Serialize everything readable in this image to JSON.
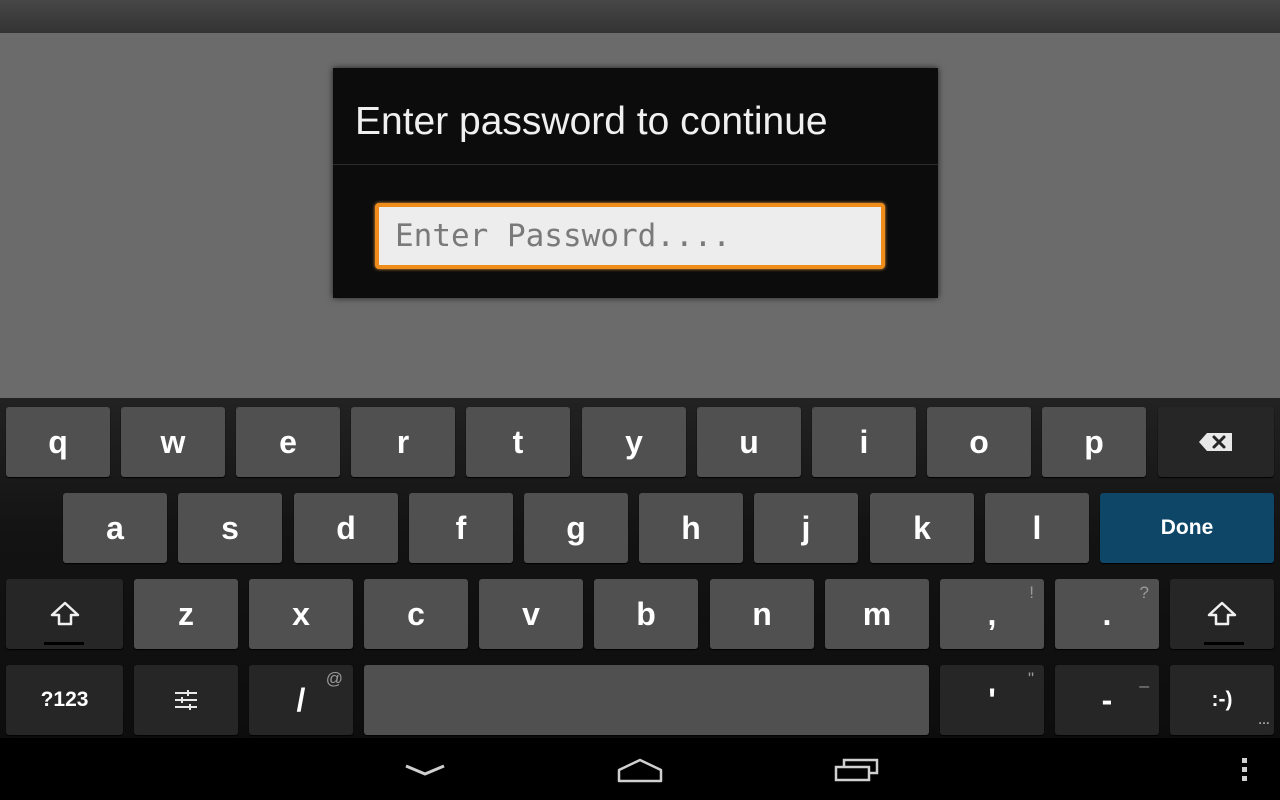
{
  "dialog": {
    "title": "Enter password to continue",
    "password_placeholder": "Enter Password....",
    "password_value": ""
  },
  "keyboard": {
    "row1": [
      "q",
      "w",
      "e",
      "r",
      "t",
      "y",
      "u",
      "i",
      "o",
      "p"
    ],
    "row2": [
      "a",
      "s",
      "d",
      "f",
      "g",
      "h",
      "j",
      "k",
      "l"
    ],
    "row3": [
      "z",
      "x",
      "c",
      "v",
      "b",
      "n",
      "m"
    ],
    "done_label": "Done",
    "comma_label": ",",
    "comma_hint": "!",
    "period_label": ".",
    "period_hint": "?",
    "symbols_label": "?123",
    "slash_label": "/",
    "slash_hint": "@",
    "apostrophe_label": "'",
    "apostrophe_hint": "\"",
    "dash_label": "-",
    "dash_hint": "_",
    "smiley_label": ":-)",
    "icons": {
      "backspace": "backspace-icon",
      "shift": "shift-icon",
      "settings": "settings-sliders-icon"
    }
  },
  "nav": {
    "icons": [
      "back-icon",
      "home-icon",
      "recent-apps-icon",
      "menu-icon"
    ]
  },
  "colors": {
    "accent": "#f08c1a",
    "done_key": "#0e4668",
    "key": "#505050",
    "dark_key": "#262626"
  }
}
